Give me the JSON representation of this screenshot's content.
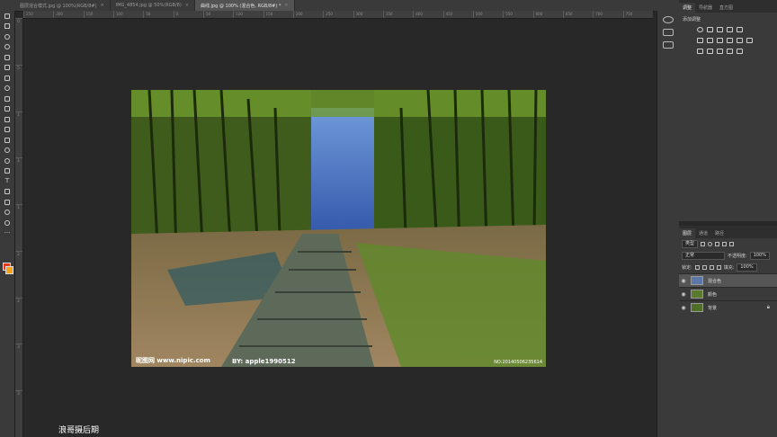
{
  "tabs": [
    {
      "label": "图层混合模式.jpg @ 100%(RGB/8#)",
      "active": false
    },
    {
      "label": "IMG_4854.jpg @ 50%(RGB/8)",
      "active": false
    },
    {
      "label": "曲线.jpg @ 100% (混合色, RGB/8#) *",
      "active": true
    }
  ],
  "ruler_top": [
    "250",
    "200",
    "150",
    "100",
    "50",
    "0",
    "50",
    "100",
    "150",
    "200",
    "250",
    "300",
    "350",
    "400",
    "450",
    "500",
    "550",
    "600",
    "650",
    "700",
    "750"
  ],
  "ruler_left": [
    "0",
    "5",
    "1",
    "1",
    "1",
    "2",
    "2",
    "3",
    "3"
  ],
  "right_panel": {
    "tabs": [
      "调整",
      "导航器",
      "直方图"
    ],
    "add_adjustment": "添加调整"
  },
  "layers_panel": {
    "tabs": [
      "图层",
      "通道",
      "路径"
    ],
    "filter_kind": "类型",
    "blend_mode": "正常",
    "opacity_label": "不透明度:",
    "opacity": "100%",
    "lock_label": "锁定:",
    "fill_label": "填充:",
    "fill": "100%",
    "layers": [
      {
        "name": "混合色",
        "selected": true
      },
      {
        "name": "颜色",
        "selected": false
      },
      {
        "name": "背景",
        "selected": false
      }
    ]
  },
  "image": {
    "watermark_left": "昵图网 www.nipic.com",
    "watermark_by": "BY: apple1990512",
    "watermark_id": "NO:20140506235614"
  },
  "signature": "浪哥摄后期",
  "colors": {
    "foreground": "#e63a1f",
    "background": "#f4a11c"
  }
}
